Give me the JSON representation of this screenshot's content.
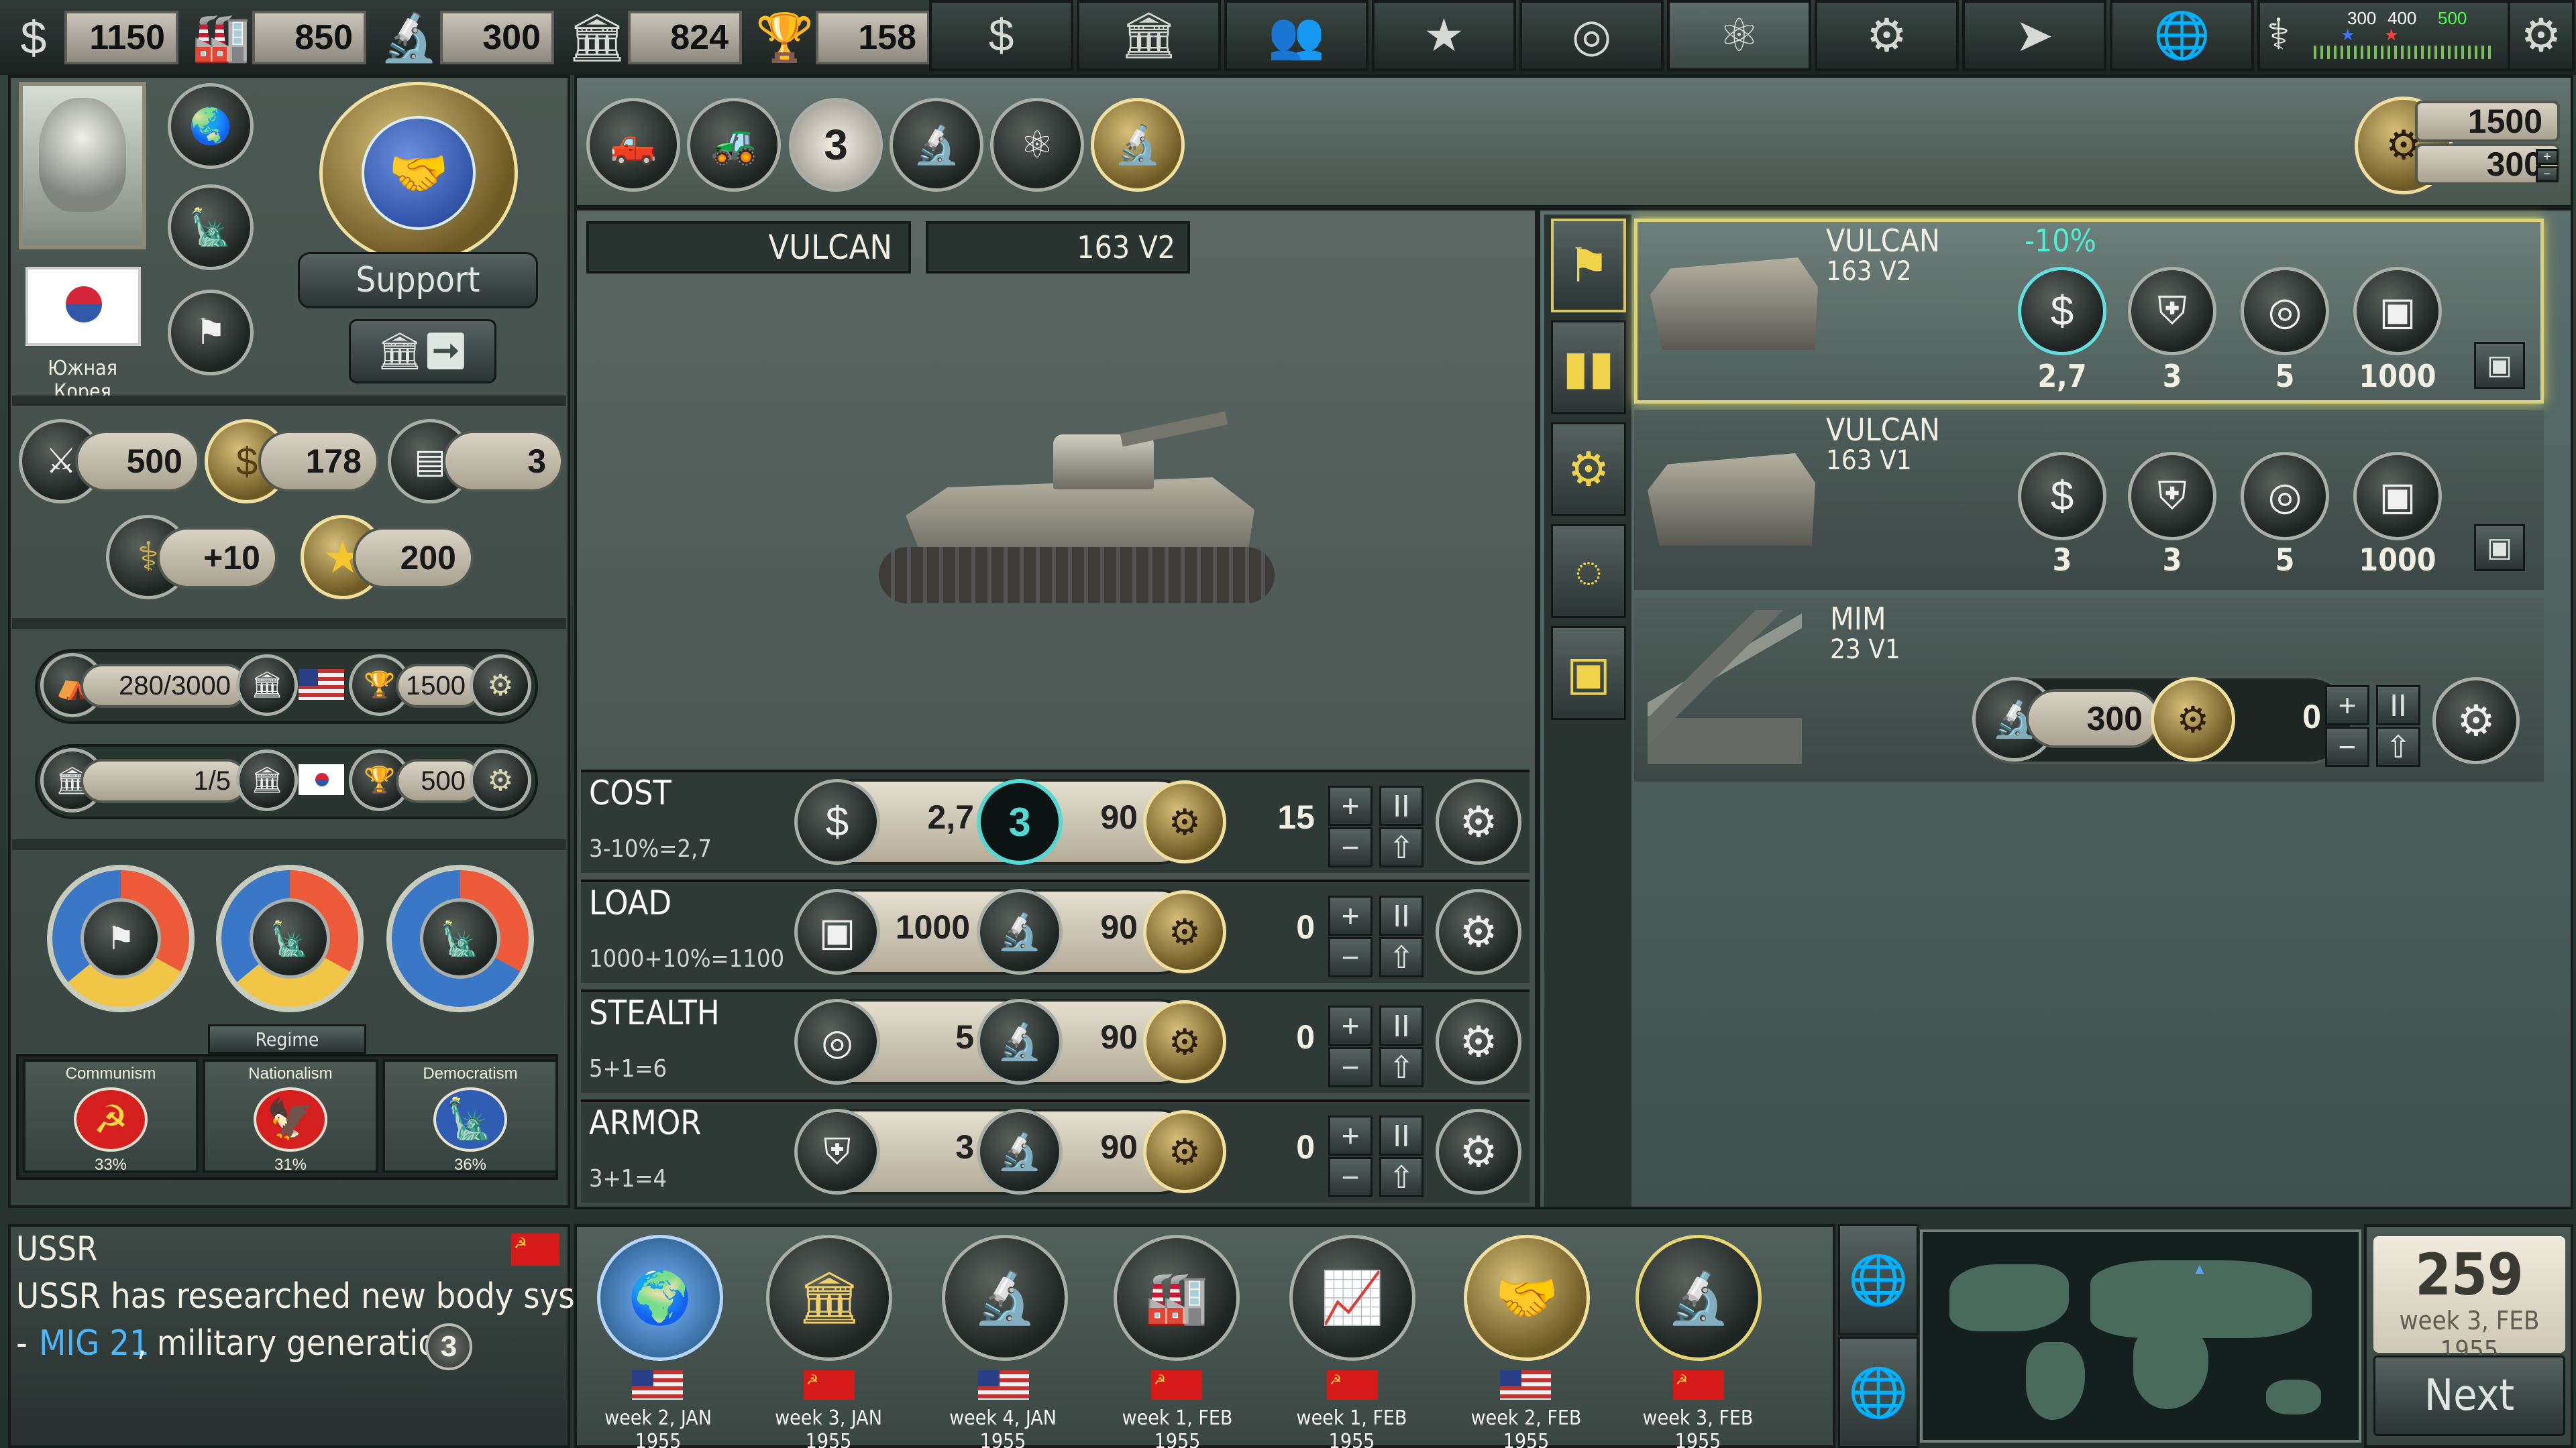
{
  "top_stats": [
    {
      "icon": "money-stack-icon",
      "value": "1150"
    },
    {
      "icon": "factory-icon",
      "value": "850"
    },
    {
      "icon": "microscope-icon",
      "value": "300"
    },
    {
      "icon": "government-building-icon",
      "value": "824"
    },
    {
      "icon": "victory-cup-icon",
      "value": "158"
    }
  ],
  "top_tabs": [
    {
      "icon": "economy-tab-icon",
      "symbol": "$"
    },
    {
      "icon": "bank-tab-icon",
      "symbol": "🏛"
    },
    {
      "icon": "population-tab-icon",
      "symbol": "👥"
    },
    {
      "icon": "military-tab-icon",
      "symbol": "★"
    },
    {
      "icon": "diplomacy-tab-icon",
      "symbol": "◎"
    },
    {
      "icon": "science-tab-icon",
      "symbol": "⚛"
    },
    {
      "icon": "production-tab-icon",
      "symbol": "⚙"
    },
    {
      "icon": "missile-tab-icon",
      "symbol": "➤"
    },
    {
      "icon": "world-tab-icon",
      "symbol": "🌐"
    }
  ],
  "defcon": {
    "left": "300",
    "mid": "400",
    "right": "500"
  },
  "country": {
    "name": "Южная Корея",
    "support_label": "Support"
  },
  "left_stats": {
    "rifles": "500",
    "budget": "178",
    "ammo": "3",
    "health": "+10",
    "stars": "200",
    "camp_label": "280/3000",
    "camp_bonus": "1500",
    "bank_label": "1/5",
    "bank_bonus": "500",
    "regime_label": "Regime",
    "ideologies": [
      {
        "name": "Communism",
        "percent": "33%"
      },
      {
        "name": "Nationalism",
        "percent": "31%"
      },
      {
        "name": "Democratism",
        "percent": "36%"
      }
    ]
  },
  "top_research": {
    "level": "3",
    "resource_a": "1500",
    "resource_b": "300"
  },
  "details": {
    "name": "VULCAN",
    "model": "163 V2",
    "rows": [
      {
        "label": "COST",
        "sub": "3-10%=2,7",
        "left_value": "2,7",
        "level": "3",
        "right_value": "90",
        "count": "15"
      },
      {
        "label": "LOAD",
        "sub": "1000+10%=1100",
        "left_value": "1000",
        "right_value": "90",
        "count": "0"
      },
      {
        "label": "STEALTH",
        "sub": "5+1=6",
        "left_value": "5",
        "right_value": "90",
        "count": "0"
      },
      {
        "label": "ARMOR",
        "sub": "3+1=4",
        "left_value": "3",
        "right_value": "90",
        "count": "0"
      }
    ]
  },
  "side_tabs": [
    "flag-icon",
    "ammo-icon",
    "engine-icon",
    "radar-icon",
    "storage-icon"
  ],
  "units": [
    {
      "name": "VULCAN",
      "model": "163 V2",
      "discount": "-10%",
      "cost": "2,7",
      "armor": "3",
      "stealth": "5",
      "load": "1000"
    },
    {
      "name": "VULCAN",
      "model": "163 V1",
      "cost": "3",
      "armor": "3",
      "stealth": "5",
      "load": "1000"
    },
    {
      "name": "MIM",
      "model": "23 V1",
      "resource_value": "300",
      "progress": "0"
    }
  ],
  "news": {
    "country": "USSR",
    "text_1": "USSR has researched new body system",
    "text_2_prefix": "-",
    "text_2_highlight": "MIG 21",
    "text_2_suffix": ", military generation",
    "badge": "3"
  },
  "timeline": [
    {
      "week": "week 2, JAN 1955",
      "flag": "us"
    },
    {
      "week": "week 3, JAN 1955",
      "flag": "su"
    },
    {
      "week": "week 4, JAN 1955",
      "flag": "us"
    },
    {
      "week": "week 1, FEB 1955",
      "flag": "su"
    },
    {
      "week": "week 1, FEB 1955",
      "flag": "su"
    },
    {
      "week": "week 2, FEB 1955",
      "flag": "us"
    },
    {
      "week": "week 3, FEB 1955",
      "flag": "su"
    }
  ],
  "turn": {
    "number": "259",
    "date": "week 3, FEB 1955",
    "next_label": "Next"
  }
}
